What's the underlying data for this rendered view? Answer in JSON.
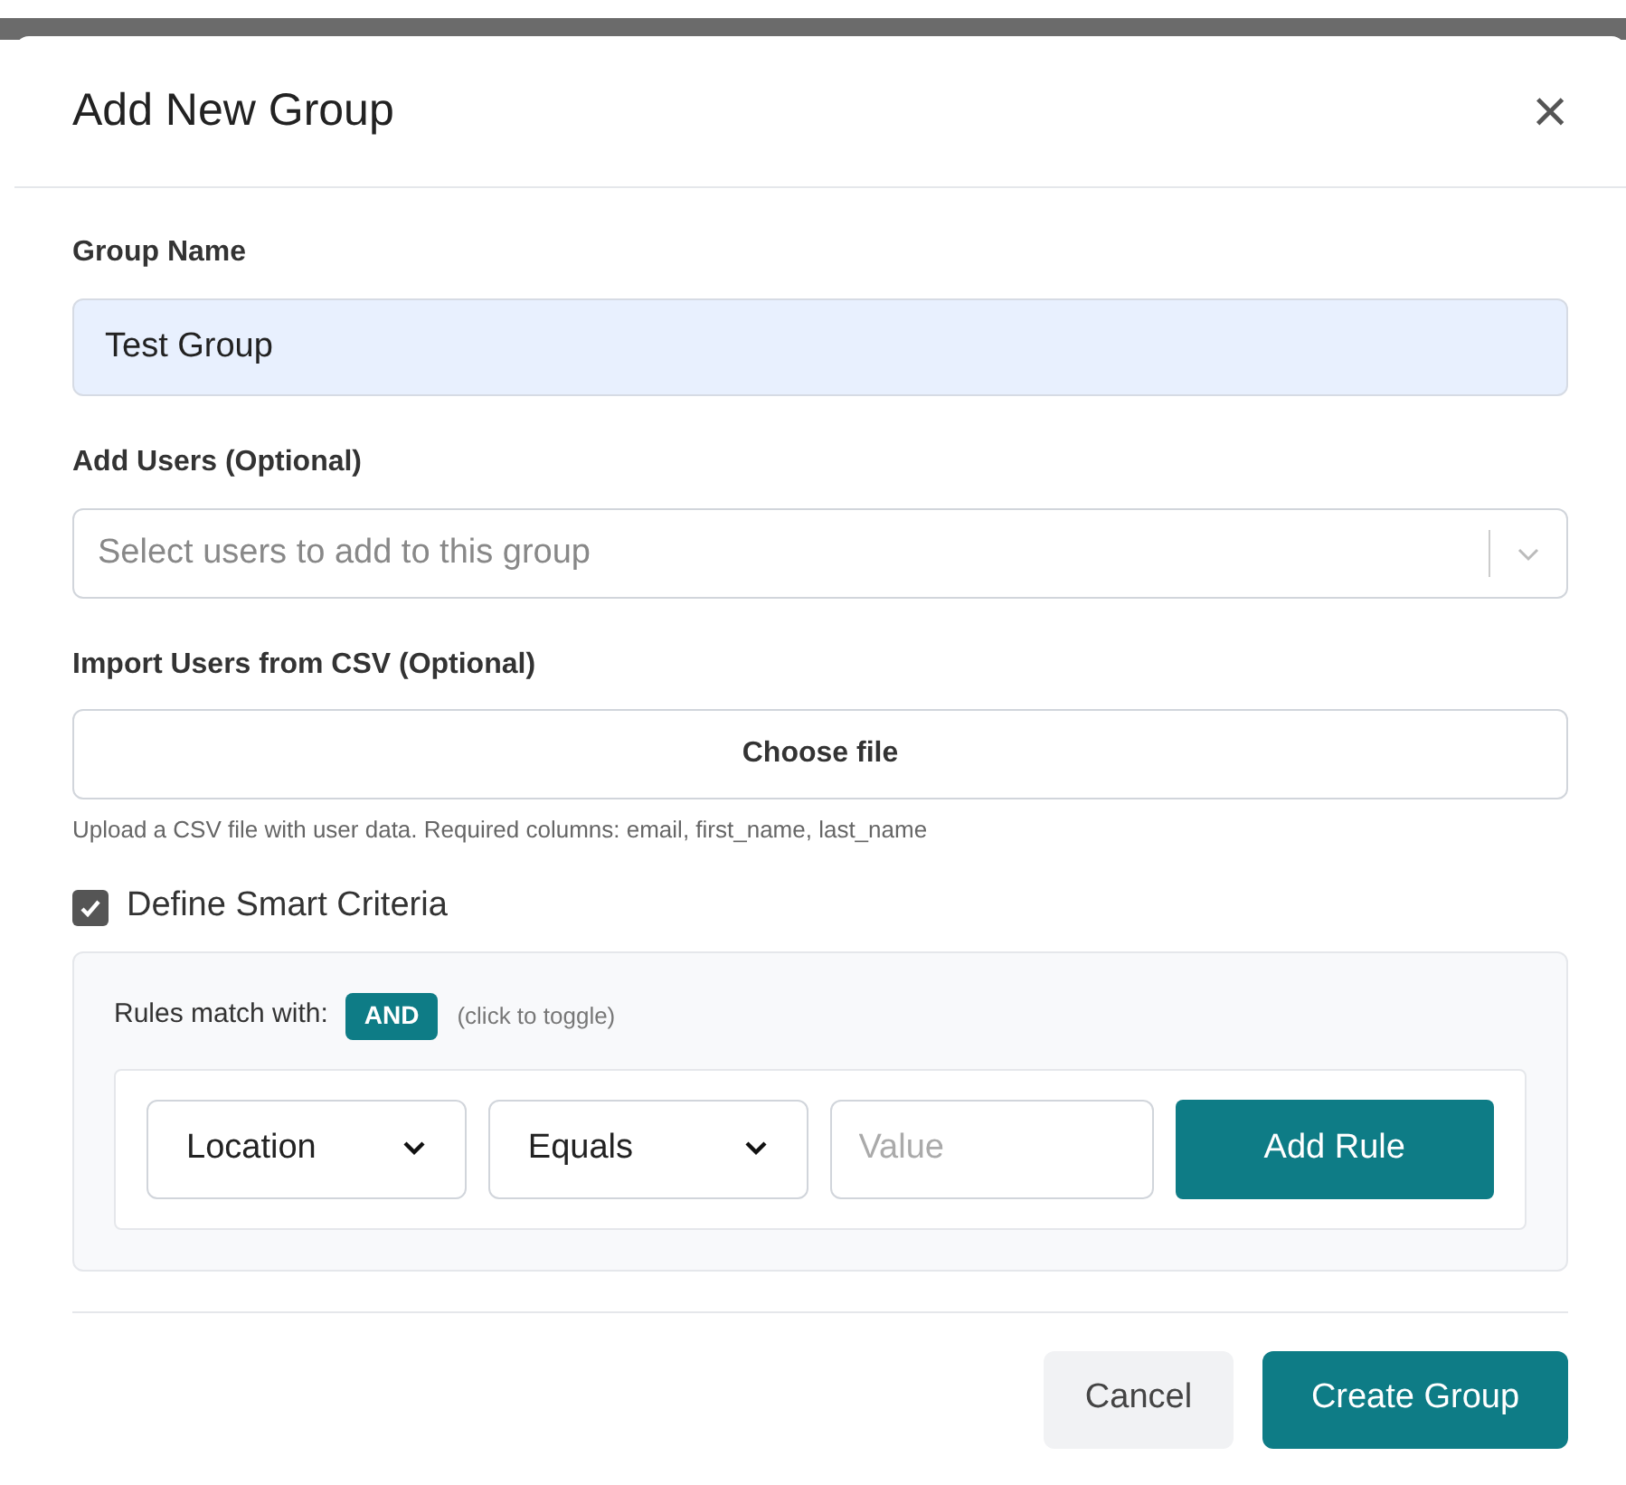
{
  "dialog": {
    "title": "Add New Group",
    "close": "×"
  },
  "group_name": {
    "label": "Group Name",
    "value": "Test Group"
  },
  "add_users": {
    "label": "Add Users (Optional)",
    "placeholder": "Select users to add to this group"
  },
  "import_csv": {
    "label": "Import Users from CSV (Optional)",
    "button": "Choose file",
    "help": "Upload a CSV file with user data. Required columns: email, first_name, last_name"
  },
  "smart_criteria": {
    "label": "Define Smart Criteria",
    "checked": true
  },
  "rules": {
    "match_label": "Rules match with:",
    "operator": "AND",
    "toggle_hint": "(click to toggle)",
    "field": "Location",
    "comparison": "Equals",
    "value_placeholder": "Value",
    "add_button": "Add Rule"
  },
  "footer": {
    "cancel": "Cancel",
    "submit": "Create Group"
  }
}
